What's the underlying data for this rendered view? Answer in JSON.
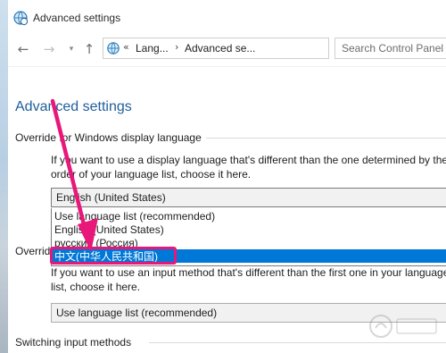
{
  "window": {
    "title": "Advanced settings"
  },
  "nav": {
    "back_icon": "arrow-left-icon",
    "forward_icon": "arrow-right-icon",
    "history_icon": "chevron-down-icon",
    "up_icon": "arrow-up-icon"
  },
  "address": {
    "overflow": "«",
    "crumbs": [
      "Lang...",
      "Advanced se..."
    ]
  },
  "search": {
    "placeholder": "Search Control Panel"
  },
  "page": {
    "title": "Advanced settings"
  },
  "display_language": {
    "header": "Override for Windows display language",
    "description": "If you want to use a display language that's different than the one determined by the order of your language list, choose it here.",
    "selected": "English (United States)",
    "options": [
      "Use language list (recommended)",
      "English (United States)",
      "русский (Россия)",
      "中文(中华人民共和国)"
    ],
    "highlighted_index": 3
  },
  "input_method": {
    "header_fragment": "Overrid",
    "description": "If you want to use an input method that's different than the first one in your language list, choose it here.",
    "selected": "Use language list (recommended)"
  },
  "switching": {
    "header": "Switching input methods"
  },
  "annotation": {
    "color": "#e8177a"
  },
  "colors": {
    "title_blue": "#1f5e9c",
    "selection_blue": "#0078d7"
  }
}
